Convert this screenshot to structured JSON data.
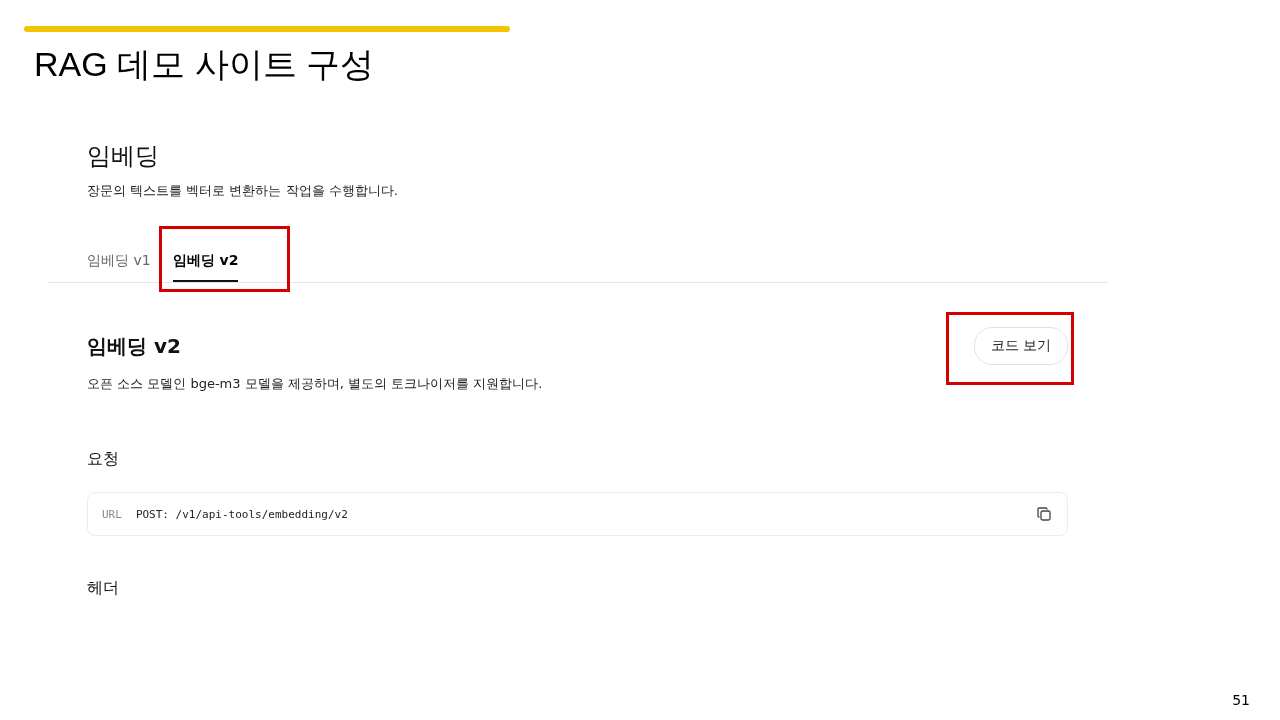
{
  "slide": {
    "title": "RAG 데모 사이트 구성",
    "page_number": "51"
  },
  "page": {
    "heading": "임베딩",
    "description": "장문의 텍스트를 벡터로 변환하는 작업을 수행합니다.",
    "tabs": [
      {
        "label": "임베딩 v1",
        "selected": false,
        "highlighted": false
      },
      {
        "label": "임베딩 v2",
        "selected": true,
        "highlighted": true
      }
    ],
    "section": {
      "title": "임베딩 v2",
      "description": "오픈 소스 모델인 bge-m3 모델을 제공하며, 별도의 토크나이저를 지원합니다.",
      "button": {
        "label": "코드 보기",
        "highlighted": true
      }
    },
    "request": {
      "title": "요청",
      "url_label": "URL",
      "url": "POST: /v1/api-tools/embedding/v2"
    },
    "header": {
      "title": "헤더"
    }
  }
}
